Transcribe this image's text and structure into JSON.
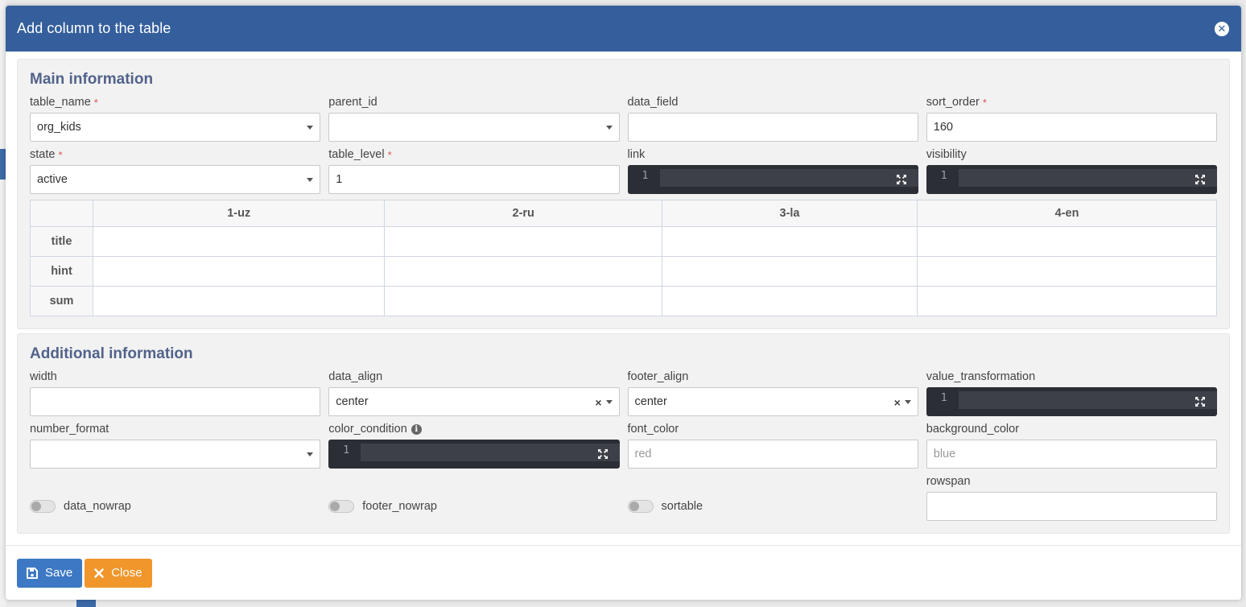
{
  "modal": {
    "title": "Add column to the table"
  },
  "main_section": {
    "title": "Main information",
    "table_name": {
      "label": "table_name",
      "value": "org_kids"
    },
    "parent_id": {
      "label": "parent_id",
      "value": ""
    },
    "data_field": {
      "label": "data_field",
      "value": ""
    },
    "sort_order": {
      "label": "sort_order",
      "value": "160"
    },
    "state": {
      "label": "state",
      "value": "active"
    },
    "table_level": {
      "label": "table_level",
      "value": "1"
    },
    "link": {
      "label": "link",
      "line_number": "1"
    },
    "visibility": {
      "label": "visibility",
      "line_number": "1"
    },
    "required_mark": "*",
    "lang_table": {
      "columns": [
        "1-uz",
        "2-ru",
        "3-la",
        "4-en"
      ],
      "rows": [
        "title",
        "hint",
        "sum"
      ]
    }
  },
  "additional_section": {
    "title": "Additional information",
    "width": {
      "label": "width",
      "value": ""
    },
    "data_align": {
      "label": "data_align",
      "value": "center"
    },
    "footer_align": {
      "label": "footer_align",
      "value": "center"
    },
    "value_transformation": {
      "label": "value_transformation",
      "line_number": "1"
    },
    "number_format": {
      "label": "number_format",
      "value": ""
    },
    "color_condition": {
      "label": "color_condition",
      "line_number": "1"
    },
    "font_color": {
      "label": "font_color",
      "placeholder": "red"
    },
    "background_color": {
      "label": "background_color",
      "placeholder": "blue"
    },
    "data_nowrap": {
      "label": "data_nowrap"
    },
    "footer_nowrap": {
      "label": "footer_nowrap"
    },
    "sortable": {
      "label": "sortable"
    },
    "rowspan": {
      "label": "rowspan",
      "value": ""
    }
  },
  "footer": {
    "save_label": "Save",
    "close_label": "Close"
  },
  "colors": {
    "header": "#345f9c",
    "save": "#3c78c3",
    "close": "#f0962b",
    "section_title": "#52638a"
  }
}
